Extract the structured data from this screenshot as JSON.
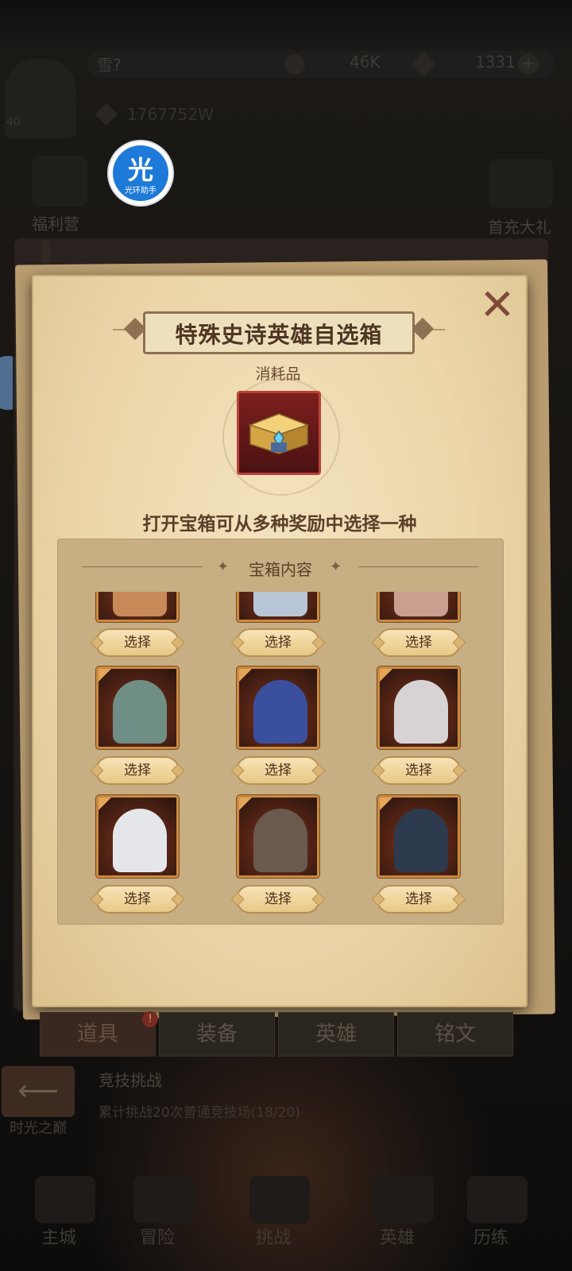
{
  "header": {
    "player_name": "雪?",
    "gold": "46K",
    "gems": "1331",
    "power": "1767752W",
    "level": "40"
  },
  "side": {
    "left_label": "福利营",
    "right_label": "首充大礼"
  },
  "assistant": {
    "char": "光",
    "label": "光环助手"
  },
  "modal": {
    "title": "特殊史诗英雄自选箱",
    "item_type": "消耗品",
    "description": "打开宝箱可从多种奖励中选择一种",
    "contents_title": "宝箱内容",
    "close_symbol": "✕",
    "heroes": [
      {
        "name": "hero-1",
        "color": "#c98a5a",
        "button": "选择"
      },
      {
        "name": "hero-2",
        "color": "#b9c6d8",
        "button": "选择"
      },
      {
        "name": "hero-3",
        "color": "#c9a08f",
        "button": "选择"
      },
      {
        "name": "hero-4",
        "color": "#6f8f86",
        "button": "选择"
      },
      {
        "name": "hero-5",
        "color": "#3a4f9e",
        "button": "选择"
      },
      {
        "name": "hero-6",
        "color": "#d7d3d5",
        "button": "选择"
      },
      {
        "name": "hero-7",
        "color": "#e5e6ea",
        "button": "选择"
      },
      {
        "name": "hero-8",
        "color": "#6a5a4e",
        "button": "选择"
      },
      {
        "name": "hero-9",
        "color": "#2d3a4e",
        "button": "选择"
      }
    ]
  },
  "tabs": [
    {
      "label": "道具",
      "badge": "!"
    },
    {
      "label": "装备"
    },
    {
      "label": "英雄"
    },
    {
      "label": "铭文"
    }
  ],
  "quest": {
    "title": "竞技挑战",
    "desc": "累计挑战20次普通竞技场(18/20)",
    "back_label": "时光之巅"
  },
  "nav": [
    "主城",
    "冒险",
    "挑战",
    "英雄",
    "历练"
  ]
}
